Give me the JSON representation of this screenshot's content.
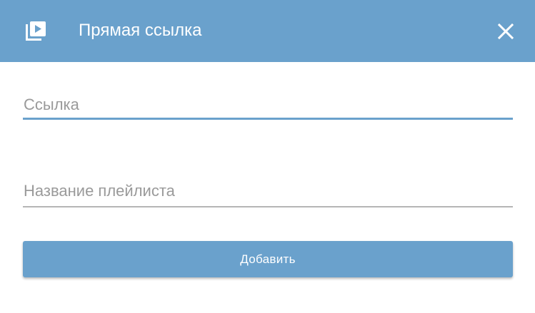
{
  "dialog": {
    "title": "Прямая ссылка",
    "header_icon": "playlist-play-icon",
    "close_icon": "close-icon",
    "accent_color": "#6aa1cc"
  },
  "form": {
    "link_placeholder": "Ссылка",
    "link_value": "",
    "playlist_placeholder": "Название плейлиста",
    "playlist_value": "",
    "submit_label": "Добавить"
  }
}
